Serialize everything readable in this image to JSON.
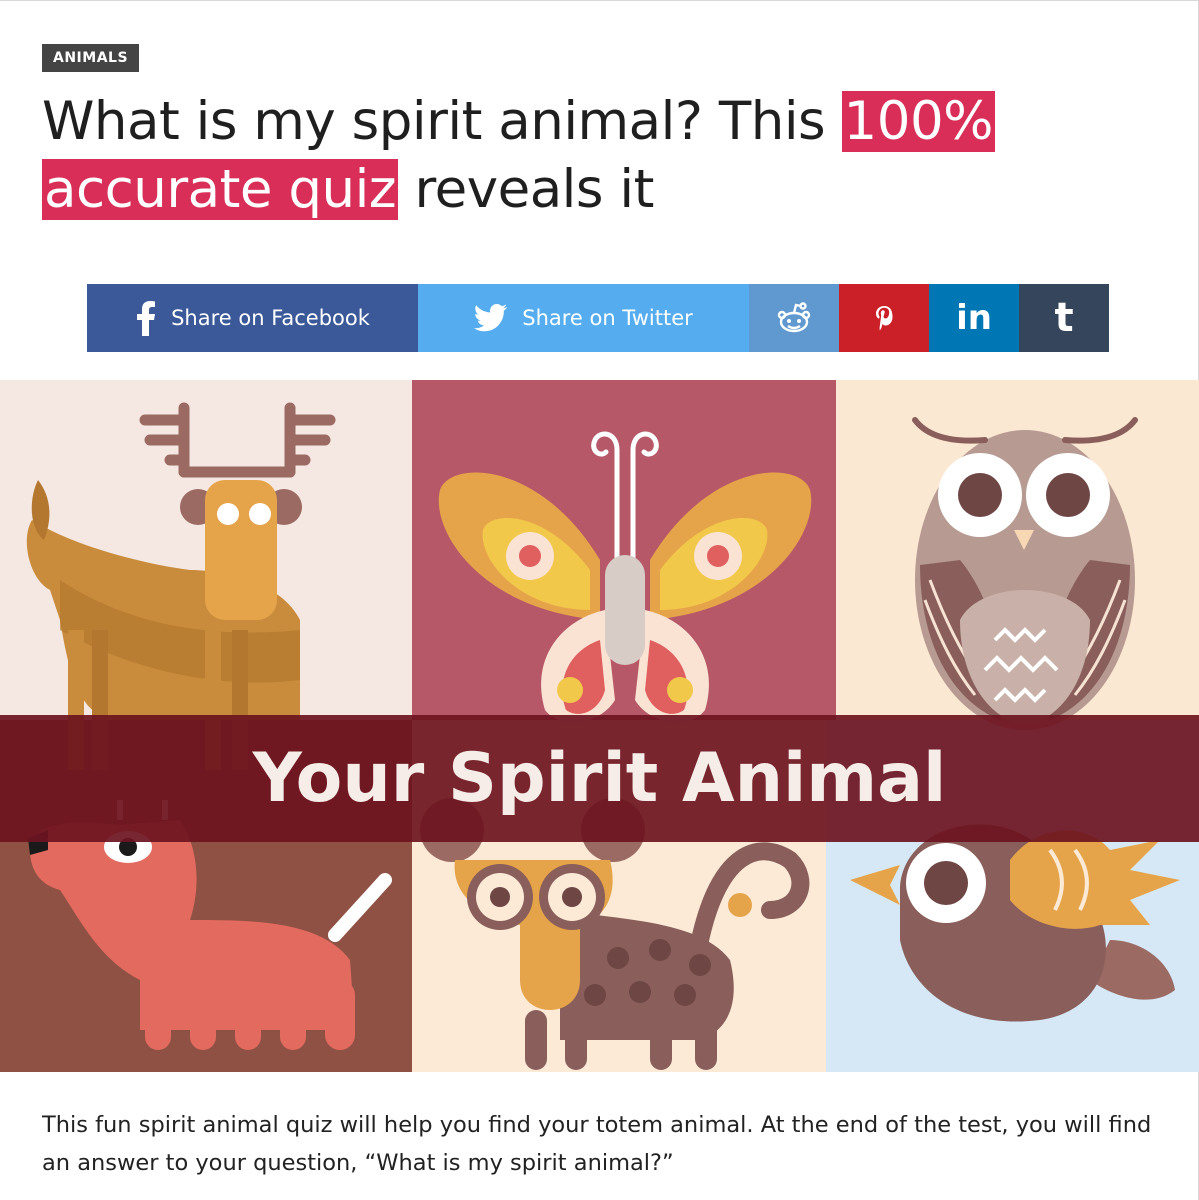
{
  "article": {
    "category": "ANIMALS",
    "headline": {
      "part1": "What is my spirit animal? This ",
      "highlight": "100% accurate quiz",
      "part2": " reveals it"
    },
    "intro": "This fun spirit animal quiz will help you find your totem animal. At the end of the test, you will find an answer to your question, “What is my spirit animal?”"
  },
  "share": {
    "facebook_label": "Share on Facebook",
    "twitter_label": "Share on Twitter",
    "buttons": [
      {
        "network": "facebook",
        "icon": "facebook-icon",
        "color": "#3b5998"
      },
      {
        "network": "twitter",
        "icon": "twitter-icon",
        "color": "#55acee"
      },
      {
        "network": "reddit",
        "icon": "reddit-icon",
        "color": "#5f99cf"
      },
      {
        "network": "pinterest",
        "icon": "pinterest-icon",
        "color": "#cb2027"
      },
      {
        "network": "linkedin",
        "icon": "linkedin-icon",
        "color": "#0077b5"
      },
      {
        "network": "tumblr",
        "icon": "tumblr-icon",
        "color": "#35465c"
      }
    ]
  },
  "hero": {
    "banner_text": "Your Spirit Animal",
    "animals": [
      "moose",
      "butterfly",
      "owl",
      "dog",
      "lemur",
      "bird"
    ]
  },
  "colors": {
    "highlight": "#d92e57",
    "tag_bg": "#444444",
    "banner_bg": "#6c1420"
  }
}
